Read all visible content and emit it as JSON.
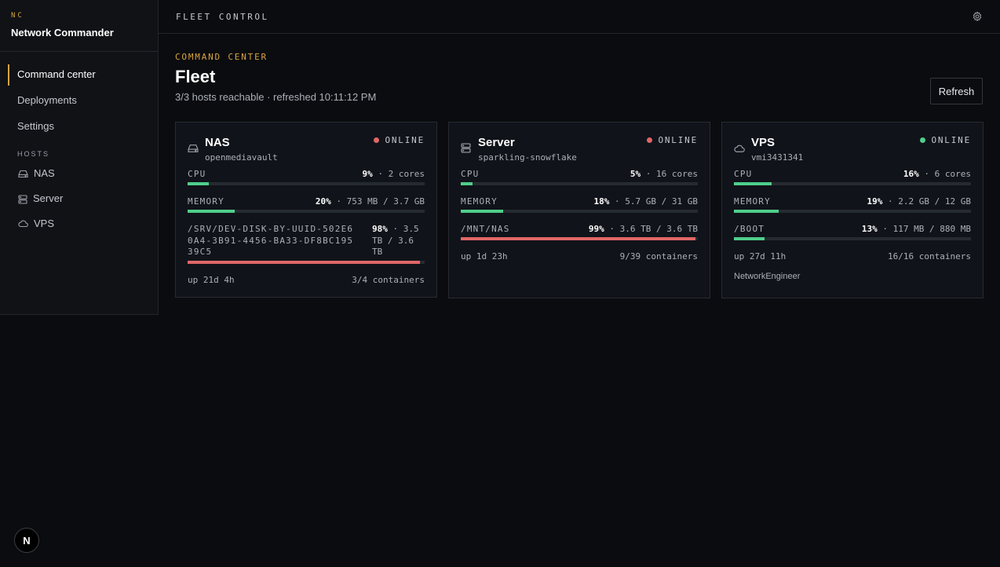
{
  "brand": {
    "mark": "NC",
    "name": "Network Commander"
  },
  "nav": [
    {
      "label": "Command center"
    },
    {
      "label": "Deployments"
    },
    {
      "label": "Settings"
    }
  ],
  "hosts_nav": {
    "header": "HOSTS",
    "items": [
      {
        "label": "NAS",
        "icon": "drive-icon"
      },
      {
        "label": "Server",
        "icon": "server-icon"
      },
      {
        "label": "VPS",
        "icon": "cloud-icon"
      }
    ]
  },
  "topbar": {
    "title": "FLEET CONTROL",
    "icon": "gear-icon"
  },
  "main": {
    "eyebrow": "COMMAND CENTER",
    "title": "Fleet",
    "subtitle": "3/3 hosts reachable · refreshed 10:11:12 PM",
    "refresh_label": "Refresh"
  },
  "colors": {
    "accent": "#d9a441",
    "ok": "#4fce8a",
    "warn": "#e06767",
    "danger": "#e06767"
  },
  "cards": [
    {
      "name": "NAS",
      "hostname": "openmediavault",
      "status": "ONLINE",
      "status_color": "#e06767",
      "cpu": {
        "label": "CPU",
        "pct": "9%",
        "detail": " · 2 cores",
        "fraction": 0.09
      },
      "memory": {
        "label": "MEMORY",
        "pct": "20%",
        "detail": " · 753 MB / 3.7 GB",
        "fraction": 0.2
      },
      "disk": {
        "label": "/SRV/DEV-DISK-BY-UUID-502E60A4-3B91-4456-BA33-DF8BC19539C5",
        "pct": "98%",
        "detail": " · 3.5 TB / 3.6 TB",
        "fraction": 0.98
      },
      "uptime": "up 21d 4h",
      "containers": "3/4 containers"
    },
    {
      "name": "Server",
      "hostname": "sparkling-snowflake",
      "status": "ONLINE",
      "status_color": "#e06767",
      "cpu": {
        "label": "CPU",
        "pct": "5%",
        "detail": " · 16 cores",
        "fraction": 0.05
      },
      "memory": {
        "label": "MEMORY",
        "pct": "18%",
        "detail": " · 5.7 GB / 31 GB",
        "fraction": 0.18
      },
      "disk": {
        "label": "/MNT/NAS",
        "pct": "99%",
        "detail": " · 3.6 TB / 3.6 TB",
        "fraction": 0.99
      },
      "uptime": "up 1d 23h",
      "containers": "9/39 containers"
    },
    {
      "name": "VPS",
      "hostname": "vmi3431341",
      "status": "ONLINE",
      "status_color": "#4fce8a",
      "cpu": {
        "label": "CPU",
        "pct": "16%",
        "detail": " · 6 cores",
        "fraction": 0.16
      },
      "memory": {
        "label": "MEMORY",
        "pct": "19%",
        "detail": " · 2.2 GB / 12 GB",
        "fraction": 0.19
      },
      "disk": {
        "label": "/BOOT",
        "pct": "13%",
        "detail": " · 117 MB / 880 MB",
        "fraction": 0.13
      },
      "uptime": "up 27d 11h",
      "containers": "16/16 containers",
      "user": "NetworkEngineer"
    }
  ],
  "badge": {
    "letter": "N"
  }
}
